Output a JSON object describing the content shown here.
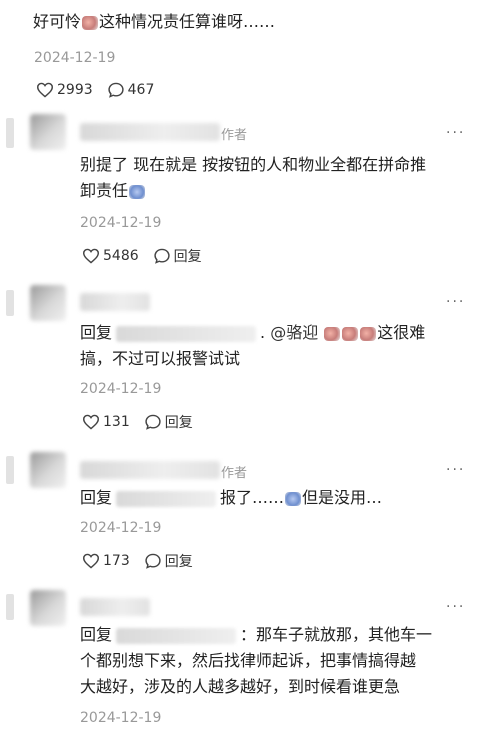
{
  "top_comment": {
    "text_a": "好可怜",
    "text_b": "这种情况责任算谁呀……",
    "date": "2024-12-19",
    "likes": "2993",
    "comments": "467"
  },
  "reply_label": "回复",
  "author_tag": "作者",
  "more": "···",
  "replies": [
    {
      "text_a": "别提了 现在就是 按按钮的人和物业全都在拼命推",
      "text_b": "卸责任",
      "date": "2024-12-19",
      "likes": "5486"
    },
    {
      "mention": "@骆迎",
      "text_a": "这很难",
      "text_b": "搞，不过可以报警试试",
      "date": "2024-12-19",
      "likes": "131"
    },
    {
      "text_a": "报了……",
      "text_b": "但是没用…",
      "date": "2024-12-19",
      "likes": "173"
    },
    {
      "text_a": "：那车子就放那，其他车一",
      "text_b": "个都别想下来，然后找律师起诉，把事情搞得越",
      "text_c": "大越好，涉及的人越多越好，到时候看谁更急",
      "date": "2024-12-19"
    }
  ]
}
